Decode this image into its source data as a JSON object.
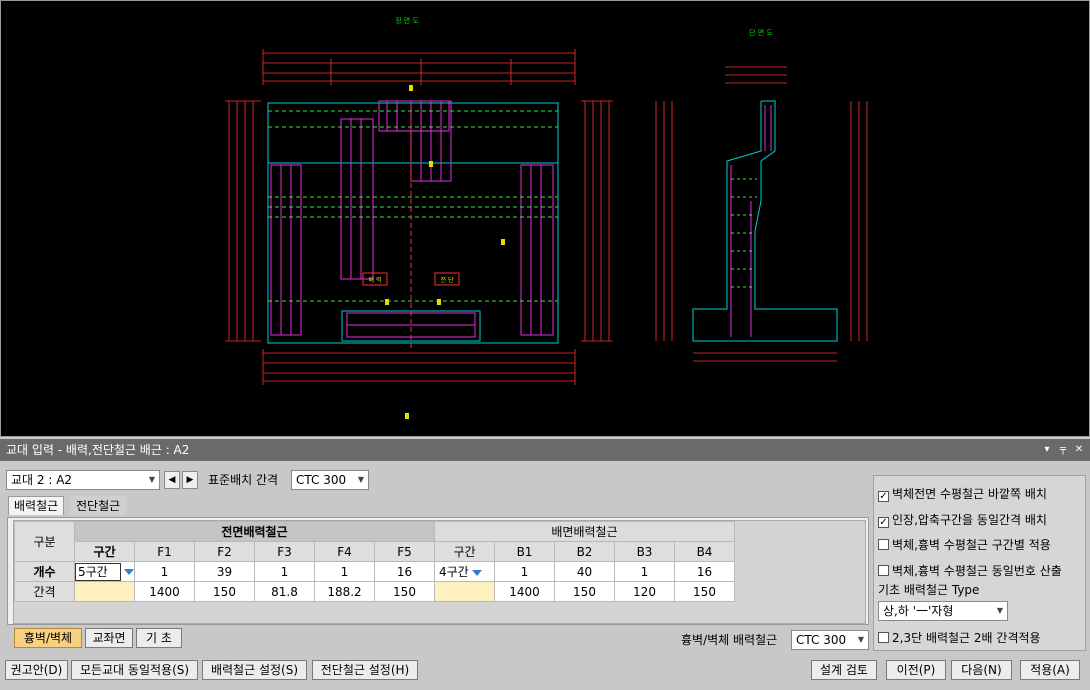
{
  "drawing": {
    "front_view_title": "정 면 도",
    "side_view_title": "단 면 도",
    "labels": [
      "배 력",
      "전 단"
    ]
  },
  "panel": {
    "title": "교대 입력 - 배력,전단철근 배근 : A2",
    "abutment_select": "교대 2 : A2",
    "std_spacing_label": "표준배치 간격",
    "std_spacing_value": "CTC 300",
    "tabs": [
      "배력철근",
      "전단철근"
    ],
    "grid": {
      "col_header": "구분",
      "front_group": "전면배력철근",
      "back_group": "배면배력철근",
      "section_label": "구간",
      "front_cols": [
        "F1",
        "F2",
        "F3",
        "F4",
        "F5"
      ],
      "back_cols": [
        "B1",
        "B2",
        "B3",
        "B4"
      ],
      "rows": [
        {
          "label": "개수",
          "front_section": "5구간",
          "front": [
            "1",
            "39",
            "1",
            "1",
            "16"
          ],
          "back_section": "4구간",
          "back": [
            "1",
            "40",
            "1",
            "16"
          ]
        },
        {
          "label": "간격",
          "front_section": "",
          "front": [
            "1400",
            "150",
            "81.8",
            "188.2",
            "150"
          ],
          "back_section": "",
          "back": [
            "1400",
            "150",
            "120",
            "150"
          ]
        }
      ]
    },
    "part_buttons": [
      "흉벽/벽체",
      "교좌면",
      "기  초"
    ],
    "wall_rebar_label": "흉벽/벽체 배력철근",
    "wall_rebar_value": "CTC 300",
    "options": {
      "opt1": "벽체전면 수평철근 바깥쪽 배치",
      "opt2": "인장,압축구간을 동일간격 배치",
      "opt3": "벽체,흉벽 수평철근 구간별 적용",
      "opt4": "벽체,흉벽 수평철근 동일번호 산출",
      "foundation_type_label": "기초 배력철근 Type",
      "foundation_type_value": "상,하 '一'자형",
      "opt5": "2,3단 배력철근 2배 간격적용"
    },
    "footer_buttons": {
      "recommend": "권고안(D)",
      "apply_all": "모든교대 동일적용(S)",
      "rebar_setting": "배력철근 설정(S)",
      "shear_setting": "전단철근 설정(H)",
      "design_check": "설계 검토",
      "prev": "이전(P)",
      "next": "다음(N)",
      "apply": "적용(A)"
    }
  }
}
